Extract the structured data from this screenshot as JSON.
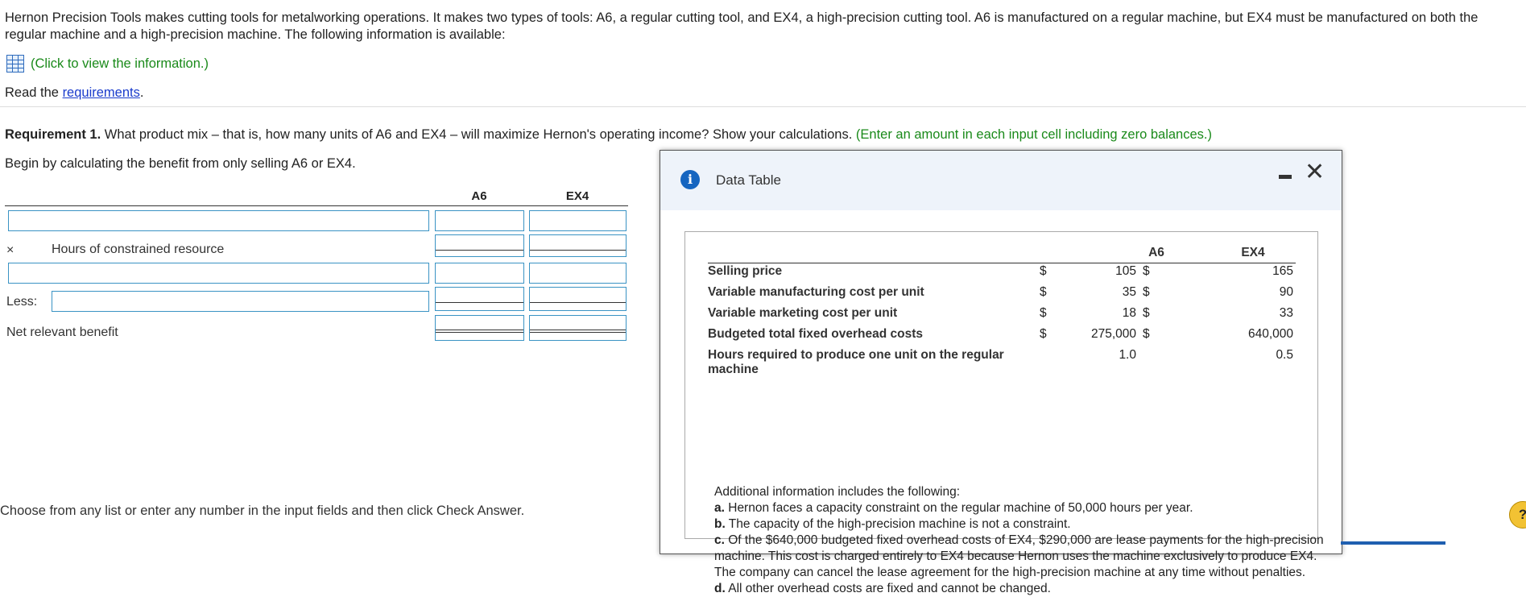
{
  "intro_text": "Hernon Precision Tools makes cutting tools for metalworking operations. It makes two types of tools: A6, a regular cutting tool, and EX4, a high-precision cutting tool. A6 is manufactured on a regular machine, but EX4 must be manufactured on both the regular machine and a high-precision machine. The following information is available:",
  "click_info": "(Click to view the information.)",
  "read_prefix": "Read the ",
  "read_link": "requirements",
  "read_suffix": ".",
  "req1_bold": "Requirement 1.",
  "req1_text": " What product mix – that is, how many units of A6 and EX4 – will maximize Hernon's operating income? Show your calculations.",
  "req1_green": " (Enter an amount in each input cell including zero balances.)",
  "begin_text": "Begin by calculating the benefit from only selling A6 or EX4.",
  "calc": {
    "col_a6": "A6",
    "col_ex4": "EX4",
    "times_symbol": "×",
    "hours_label": "Hours of constrained resource",
    "less_label": "Less:",
    "net_label": "Net relevant benefit"
  },
  "bottom_hint": "Choose from any list or enter any number in the input fields and then click Check Answer.",
  "modal": {
    "title": "Data Table",
    "col_a6": "A6",
    "col_ex4": "EX4",
    "rows": [
      {
        "label": "Selling price",
        "s1": "$",
        "a6": "105",
        "s2": "$",
        "ex4": "165"
      },
      {
        "label": "Variable manufacturing cost per unit",
        "s1": "$",
        "a6": "35",
        "s2": "$",
        "ex4": "90"
      },
      {
        "label": "Variable marketing cost per unit",
        "s1": "$",
        "a6": "18",
        "s2": "$",
        "ex4": "33"
      },
      {
        "label": "Budgeted total fixed overhead costs",
        "s1": "$",
        "a6": "275,000",
        "s2": "$",
        "ex4": "640,000"
      },
      {
        "label": "Hours required to produce one unit on the regular machine",
        "s1": "",
        "a6": "1.0",
        "s2": "",
        "ex4": "0.5"
      }
    ],
    "addl_intro": "Additional information includes the following:",
    "notes": [
      {
        "key": "a.",
        "text": " Hernon faces a capacity constraint on the regular machine of 50,000 hours per year."
      },
      {
        "key": "b.",
        "text": " The capacity of the high-precision machine is not a constraint."
      },
      {
        "key": "c.",
        "text": " Of the $640,000 budgeted fixed overhead costs of EX4, $290,000 are lease payments for the high-precision machine. This cost is charged entirely to EX4 because Hernon uses the machine exclusively to produce EX4. The company can cancel the lease agreement for the high-precision machine at any time without penalties."
      },
      {
        "key": "d.",
        "text": " All other overhead costs are fixed and cannot be changed."
      }
    ]
  },
  "help_symbol": "?"
}
